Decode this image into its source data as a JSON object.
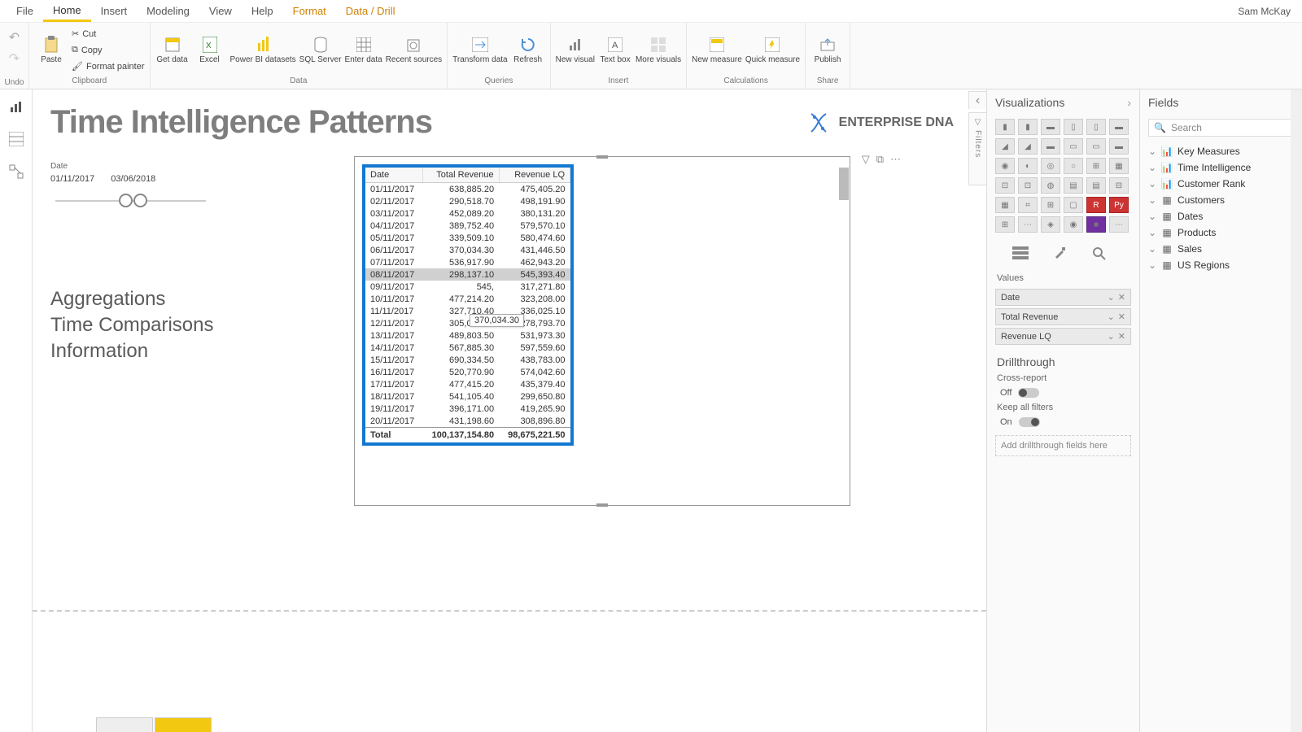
{
  "user": "Sam McKay",
  "menu": {
    "file": "File",
    "home": "Home",
    "insert": "Insert",
    "modeling": "Modeling",
    "view": "View",
    "help": "Help",
    "format": "Format",
    "data": "Data / Drill"
  },
  "ribbon": {
    "undo": "Undo",
    "clipboard": {
      "paste": "Paste",
      "cut": "Cut",
      "copy": "Copy",
      "painter": "Format painter",
      "label": "Clipboard"
    },
    "data": {
      "get": "Get data",
      "excel": "Excel",
      "pbi": "Power BI datasets",
      "sql": "SQL Server",
      "enter": "Enter data",
      "recent": "Recent sources",
      "label": "Data"
    },
    "queries": {
      "transform": "Transform data",
      "refresh": "Refresh",
      "label": "Queries"
    },
    "insert": {
      "visual": "New visual",
      "text": "Text box",
      "more": "More visuals",
      "label": "Insert"
    },
    "calc": {
      "measure": "New measure",
      "quick": "Quick measure",
      "label": "Calculations"
    },
    "share": {
      "publish": "Publish",
      "label": "Share"
    }
  },
  "page": {
    "title": "Time Intelligence Patterns",
    "brand": "ENTERPRISE DNA"
  },
  "dateFilter": {
    "label": "Date",
    "from": "01/11/2017",
    "to": "03/06/2018"
  },
  "agg": {
    "a": "Aggregations",
    "b": "Time Comparisons",
    "c": "Information"
  },
  "table": {
    "cols": [
      "Date",
      "Total Revenue",
      "Revenue LQ"
    ],
    "rows": [
      [
        "01/11/2017",
        "638,885.20",
        "475,405.20"
      ],
      [
        "02/11/2017",
        "290,518.70",
        "498,191.90"
      ],
      [
        "03/11/2017",
        "452,089.20",
        "380,131.20"
      ],
      [
        "04/11/2017",
        "389,752.40",
        "579,570.10"
      ],
      [
        "05/11/2017",
        "339,509.10",
        "580,474.60"
      ],
      [
        "06/11/2017",
        "370,034.30",
        "431,446.50"
      ],
      [
        "07/11/2017",
        "536,917.90",
        "462,943.20"
      ],
      [
        "08/11/2017",
        "298,137.10",
        "545,393.40"
      ],
      [
        "09/11/2017",
        "545,    ",
        "317,271.80"
      ],
      [
        "10/11/2017",
        "477,214.20",
        "323,208.00"
      ],
      [
        "11/11/2017",
        "327,710.40",
        "336,025.10"
      ],
      [
        "12/11/2017",
        "305,024.20",
        "278,793.70"
      ],
      [
        "13/11/2017",
        "489,803.50",
        "531,973.30"
      ],
      [
        "14/11/2017",
        "567,885.30",
        "597,559.60"
      ],
      [
        "15/11/2017",
        "690,334.50",
        "438,783.00"
      ],
      [
        "16/11/2017",
        "520,770.90",
        "574,042.60"
      ],
      [
        "17/11/2017",
        "477,415.20",
        "435,379.40"
      ],
      [
        "18/11/2017",
        "541,105.40",
        "299,650.80"
      ],
      [
        "19/11/2017",
        "396,171.00",
        "419,265.90"
      ],
      [
        "20/11/2017",
        "431,198.60",
        "308,896.80"
      ]
    ],
    "total": [
      "Total",
      "100,137,154.80",
      "98,675,221.50"
    ],
    "tooltip": "370,034.30"
  },
  "viz": {
    "title": "Visualizations",
    "values": "Values",
    "wells": [
      "Date",
      "Total Revenue",
      "Revenue LQ"
    ],
    "drill": "Drillthrough",
    "cross": "Cross-report",
    "off": "Off",
    "keep": "Keep all filters",
    "on": "On",
    "drop": "Add drillthrough fields here"
  },
  "fields": {
    "title": "Fields",
    "search": "Search",
    "items": [
      "Key Measures",
      "Time Intelligence",
      "Customer Rank",
      "Customers",
      "Dates",
      "Products",
      "Sales",
      "US Regions"
    ]
  },
  "filters": "Filters"
}
